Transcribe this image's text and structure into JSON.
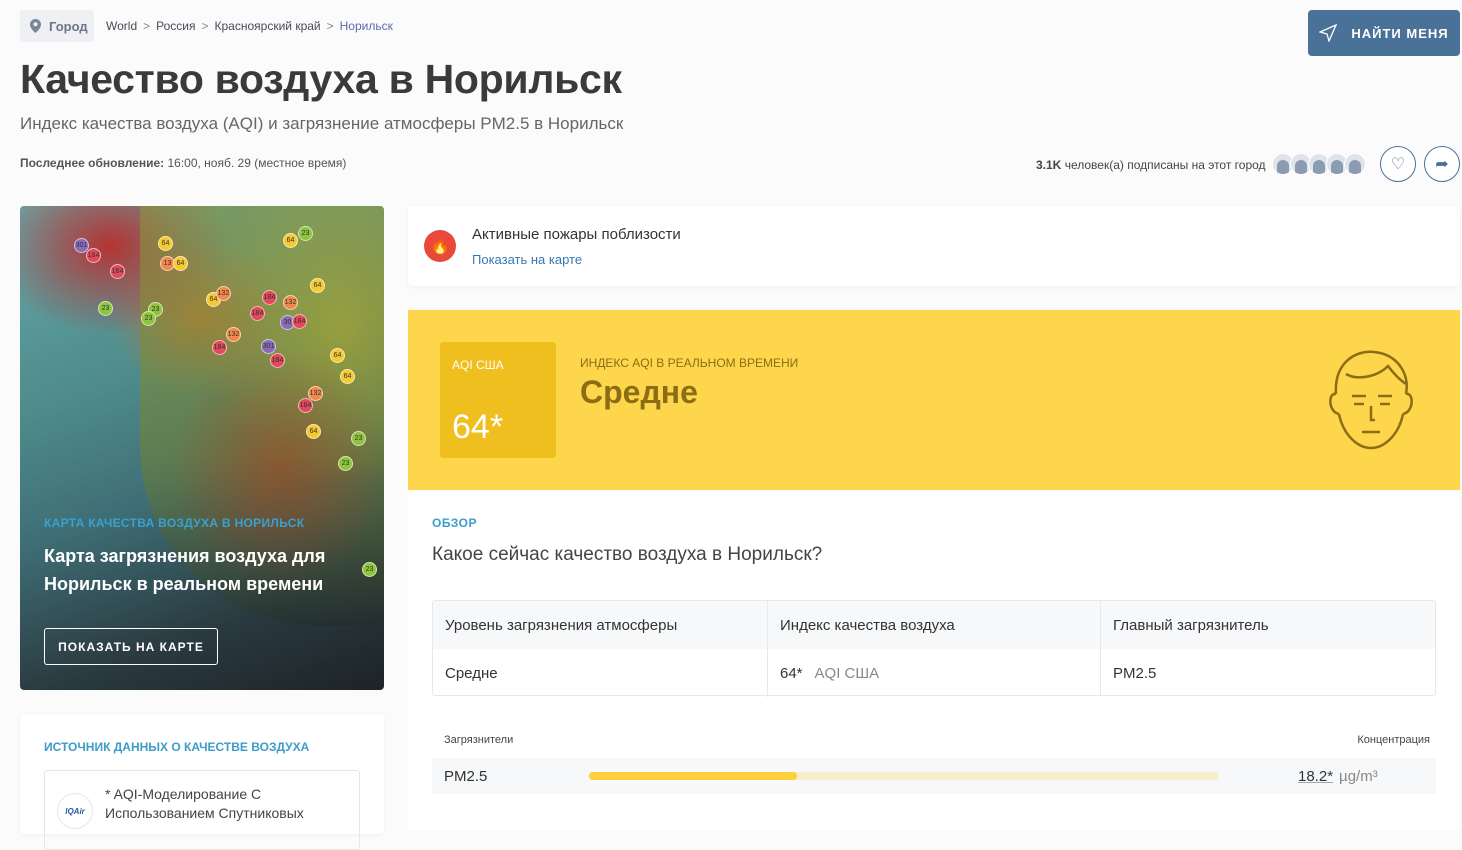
{
  "header": {
    "city_chip": "Город",
    "breadcrumbs": [
      "World",
      "Россия",
      "Красноярский край",
      "Норильск"
    ],
    "title": "Качество воздуха в Норильск",
    "subtitle": "Индекс качества воздуха (AQI) и загрязнение атмосферы PM2.5 в Норильск",
    "update_label": "Последнее обновление:",
    "update_value": "16:00, нояб. 29 (местное время)",
    "find_me": "НАЙТИ МЕНЯ",
    "followers_count": "3.1K",
    "followers_text": "человек(а) подписаны на этот город"
  },
  "map": {
    "kicker": "КАРТА КАЧЕСТВА ВОЗДУХА В НОРИЛЬСК",
    "title": "Карта загрязнения воздуха для Норильск в реальном времени",
    "button": "ПОКАЗАТЬ НА КАРТЕ",
    "markers": [
      "301",
      "184",
      "184",
      "64",
      "13",
      "64",
      "64",
      "23",
      "64",
      "23",
      "23",
      "23",
      "132",
      "184",
      "132",
      "184",
      "30",
      "184",
      "132",
      "184",
      "301",
      "184",
      "64",
      "64",
      "132",
      "184",
      "64",
      "23",
      "23",
      "64",
      "23"
    ]
  },
  "source": {
    "title": "ИСТОЧНИК ДАННЫХ О КАЧЕСТВЕ ВОЗДУХА",
    "logo": "IQAir",
    "text": "* AQI-Моделирование С Использованием Спутниковых"
  },
  "fires": {
    "title": "Активные пожары поблизости",
    "link": "Показать на карте"
  },
  "aqi": {
    "label": "AQI США",
    "value": "64*",
    "kicker": "ИНДЕКС AQI В РЕАЛЬНОМ ВРЕМЕНИ",
    "status": "Средне",
    "color": "#fdd64b"
  },
  "overview": {
    "kicker": "ОБЗОР",
    "question": "Какое сейчас качество воздуха в Норильск?",
    "headers": [
      "Уровень загрязнения атмосферы",
      "Индекс качества воздуха",
      "Главный загрязнитель"
    ],
    "level": "Средне",
    "aqi_value": "64*",
    "aqi_unit": "AQI США",
    "pollutant": "PM2.5"
  },
  "pollutants": {
    "col_left": "Загрязнители",
    "col_right": "Концентрация",
    "rows": [
      {
        "name": "PM2.5",
        "level_fraction": 0.33,
        "value": "18.2*",
        "unit": "µg/m³"
      }
    ]
  }
}
